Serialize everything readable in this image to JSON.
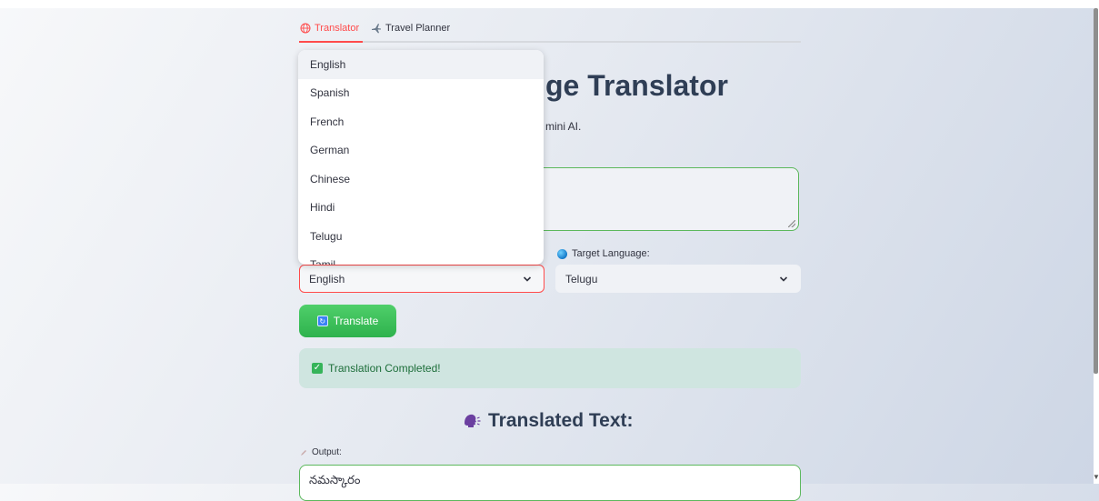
{
  "tabs": [
    {
      "label": "Translator",
      "icon": "globe-icon",
      "active": true
    },
    {
      "label": "Travel Planner",
      "icon": "airplane-icon",
      "active": false
    }
  ],
  "header": {
    "title_visible": "ge Translator",
    "subtitle_visible": "mini AI."
  },
  "source": {
    "selected": "English",
    "options": [
      "English",
      "Spanish",
      "French",
      "German",
      "Chinese",
      "Hindi",
      "Telugu",
      "Tamil"
    ],
    "highlighted": "English"
  },
  "target": {
    "label": "Target Language:",
    "selected": "Telugu"
  },
  "actions": {
    "translate_label": "Translate"
  },
  "status": {
    "message": "Translation Completed!",
    "color": "#1d6e3a"
  },
  "result": {
    "heading": "Translated Text:",
    "output_label": "Output:",
    "output_text": "నమస్కారం"
  },
  "colors": {
    "accent": "#ff4b4b",
    "button": "#2eb24d",
    "success_bg": "#cfe5e0"
  }
}
